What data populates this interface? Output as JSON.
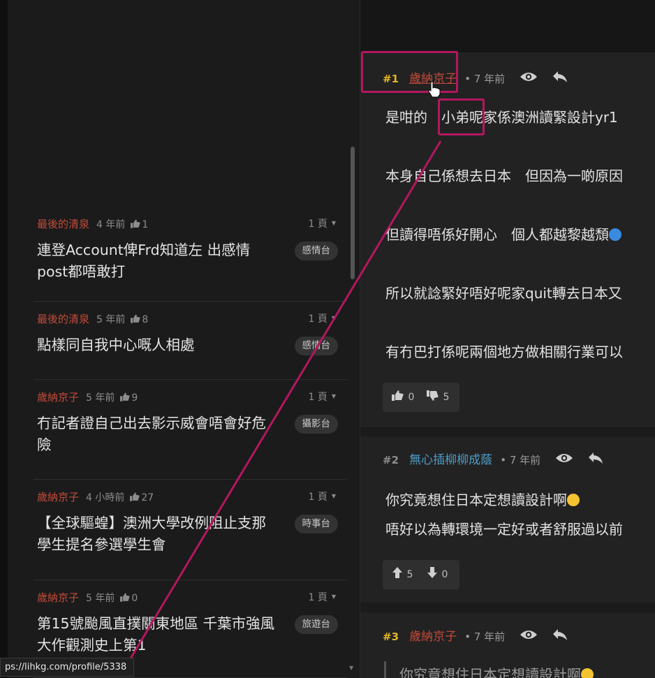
{
  "sidebar": {
    "threads": [
      {
        "author": "最後的清泉",
        "time": "4 年前",
        "likes": "1",
        "pages": "1 頁",
        "title": "連登Account俾Frd知道左 出感情post都唔敢打",
        "tag": "感情台"
      },
      {
        "author": "最後的清泉",
        "time": "5 年前",
        "likes": "8",
        "pages": "1 頁",
        "title": "點樣同自我中心嘅人相處",
        "tag": "感情台"
      },
      {
        "author": "歲納京子",
        "time": "5 年前",
        "likes": "9",
        "pages": "1 頁",
        "title": "冇記者證自己出去影示威會唔會好危險",
        "tag": "攝影台"
      },
      {
        "author": "歲納京子",
        "time": "4 小時前",
        "likes": "27",
        "pages": "1 頁",
        "title": "【全球驅蝗】澳洲大學改例阻止支那學生提名參選學生會",
        "tag": "時事台"
      },
      {
        "author": "歲納京子",
        "time": "5 年前",
        "likes": "0",
        "pages": "1 頁",
        "title": "第15號颱風直撲關東地區 千葉市強風大作觀測史上第1",
        "tag": "旅遊台"
      }
    ]
  },
  "replies": [
    {
      "num": "#1",
      "author": "歲納京子",
      "time": "7 年前",
      "lines": [
        "是咁的　小弟呢家係澳洲讀緊設計yr1",
        "本身自己係想去日本　但因為一啲原因",
        "但讀得唔係好開心　個人都越黎越頹",
        "所以就諗緊好唔好呢家quit轉去日本又",
        "有冇巴打係呢兩個地方做相關行業可以"
      ],
      "votes": {
        "up": "0",
        "down": "5"
      }
    },
    {
      "num": "#2",
      "author": "無心插柳柳成蔭",
      "time": "7 年前",
      "lines": [
        "你究竟想住日本定想讀設計啊",
        "唔好以為轉環境一定好或者舒服過以前"
      ],
      "votes": {
        "up": "5",
        "down": "0"
      }
    },
    {
      "num": "#3",
      "author": "歲納京子",
      "time": "7 年前",
      "lines": [
        "你究竟想住日本定想讀設計啊"
      ]
    }
  ],
  "status_url": "ps://lihkg.com/profile/5338",
  "colors": {
    "annotation": "#b3175f",
    "author_red": "#c44a3a",
    "author_blue": "#4f9cc7",
    "op_gold": "#e2b329"
  },
  "icons": [
    "thumb-up-icon",
    "thumb-down-icon",
    "eye-icon",
    "reply-icon",
    "caret-down-icon",
    "emoji-icon",
    "hand-cursor-icon"
  ]
}
